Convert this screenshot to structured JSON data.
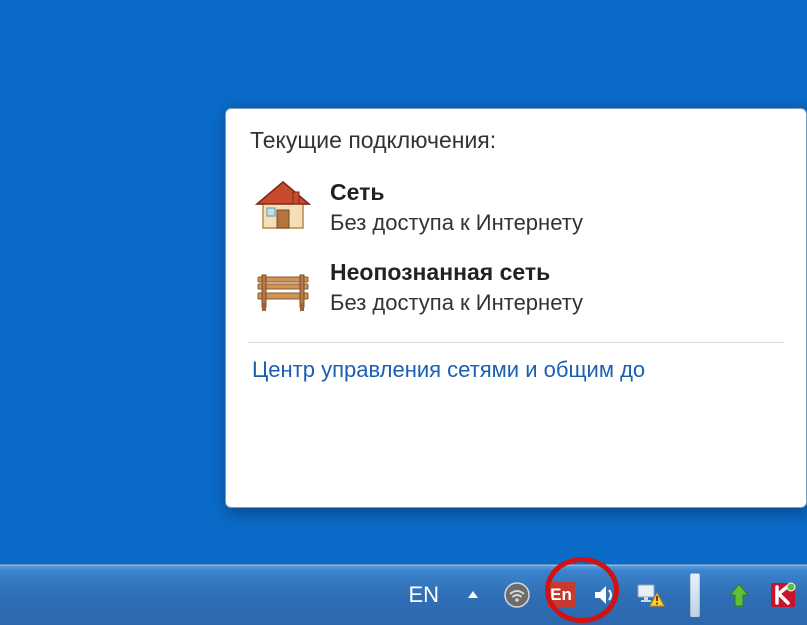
{
  "flyout": {
    "title": "Текущие подключения:",
    "connections": [
      {
        "name": "Сеть",
        "status": "Без доступа к Интернету",
        "icon": "house-icon"
      },
      {
        "name": "Неопознанная сеть",
        "status": "Без доступа к Интернету",
        "icon": "bench-icon"
      }
    ],
    "link": "Центр управления сетями и общим до"
  },
  "taskbar": {
    "language_code": "EN",
    "punto_box": "En",
    "tray_icons": {
      "show_hidden": "show-hidden-icons",
      "wifi_disabled": "wifi-disabled-icon",
      "volume": "volume-icon",
      "network_warning": "network-warning-icon",
      "update_arrow": "update-arrow-icon",
      "kaspersky": "kaspersky-icon"
    }
  },
  "colors": {
    "desktop": "#0a6ac7",
    "taskbar_top": "#5ea2df",
    "taskbar_bottom": "#2c68ad",
    "link": "#1a5fb4",
    "annotation": "#d11212"
  }
}
